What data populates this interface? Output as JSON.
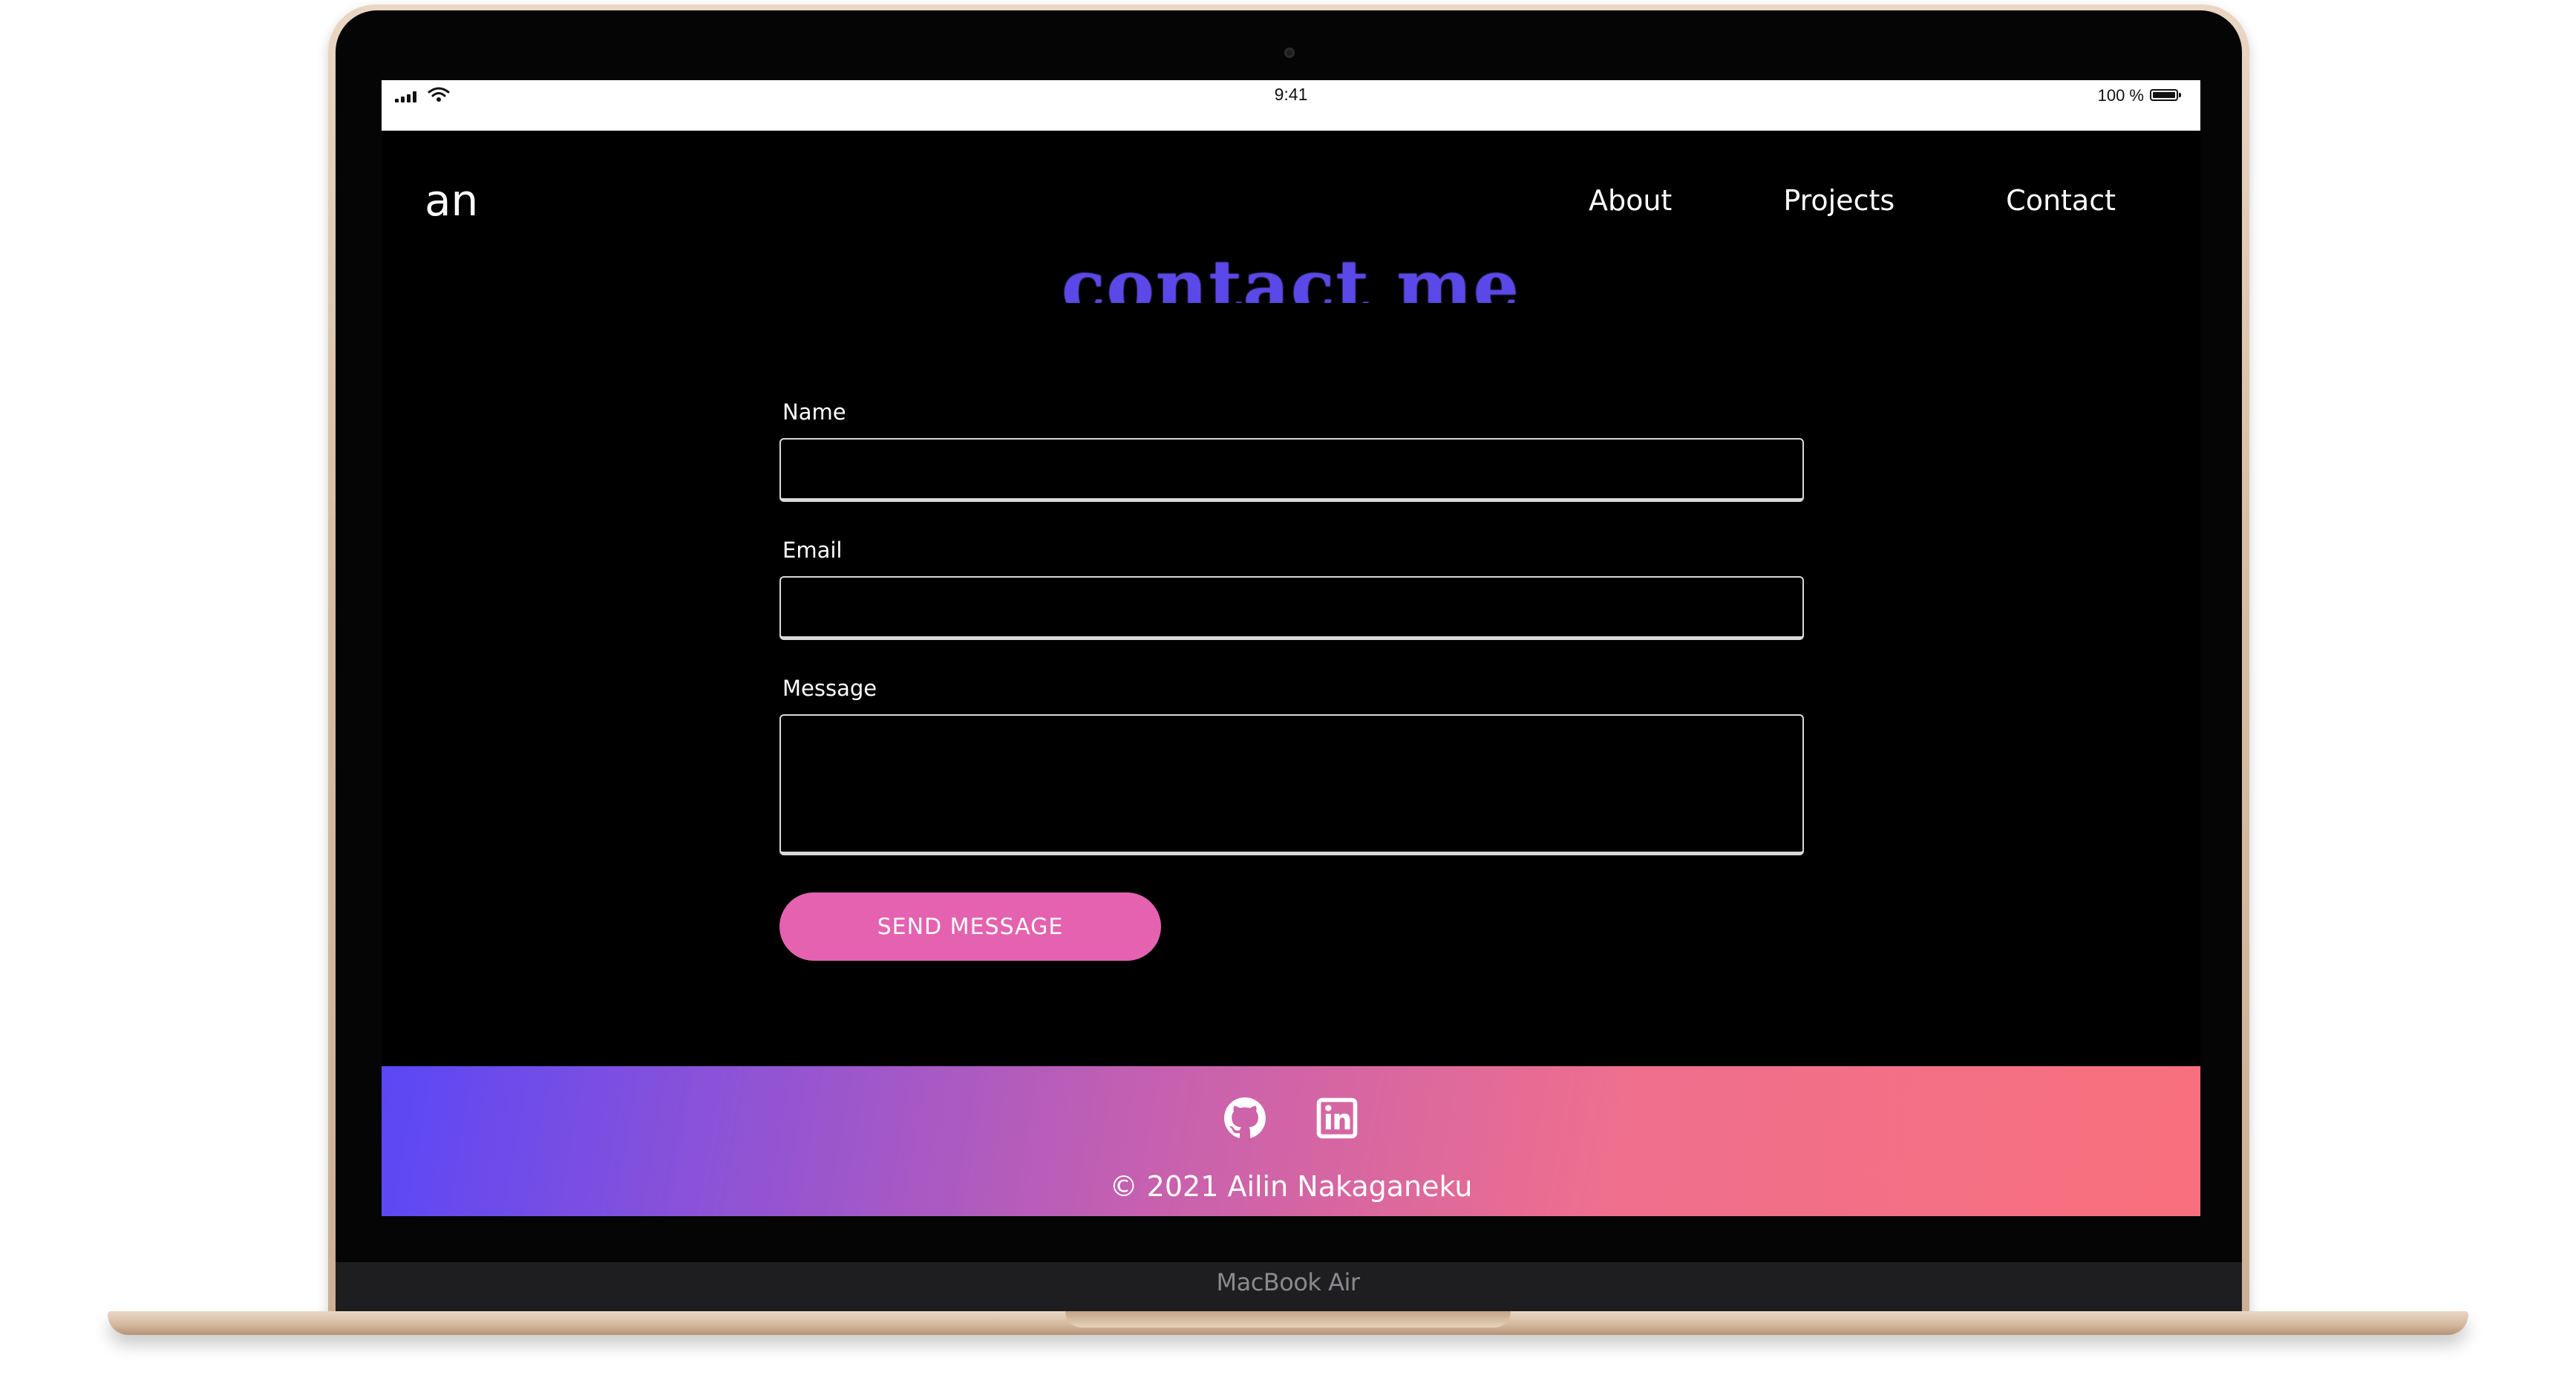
{
  "status_bar": {
    "time": "9:41",
    "battery": "100 %"
  },
  "nav": {
    "brand": "an",
    "links": [
      "About",
      "Projects",
      "Contact"
    ]
  },
  "page": {
    "heading": "contact me",
    "heading_color": "#5a48e8"
  },
  "form": {
    "name_label": "Name",
    "name_value": "",
    "email_label": "Email",
    "email_value": "",
    "message_label": "Message",
    "message_value": "",
    "submit_label": "SEND MESSAGE",
    "submit_color": "#e462b0"
  },
  "footer": {
    "icons": [
      "github-icon",
      "linkedin-icon"
    ],
    "copyright": "© 2021 Ailin Nakaganeku",
    "gradient": [
      "#5a47f6",
      "#c560b0",
      "#f8707d"
    ]
  },
  "device": {
    "label": "MacBook Air"
  }
}
